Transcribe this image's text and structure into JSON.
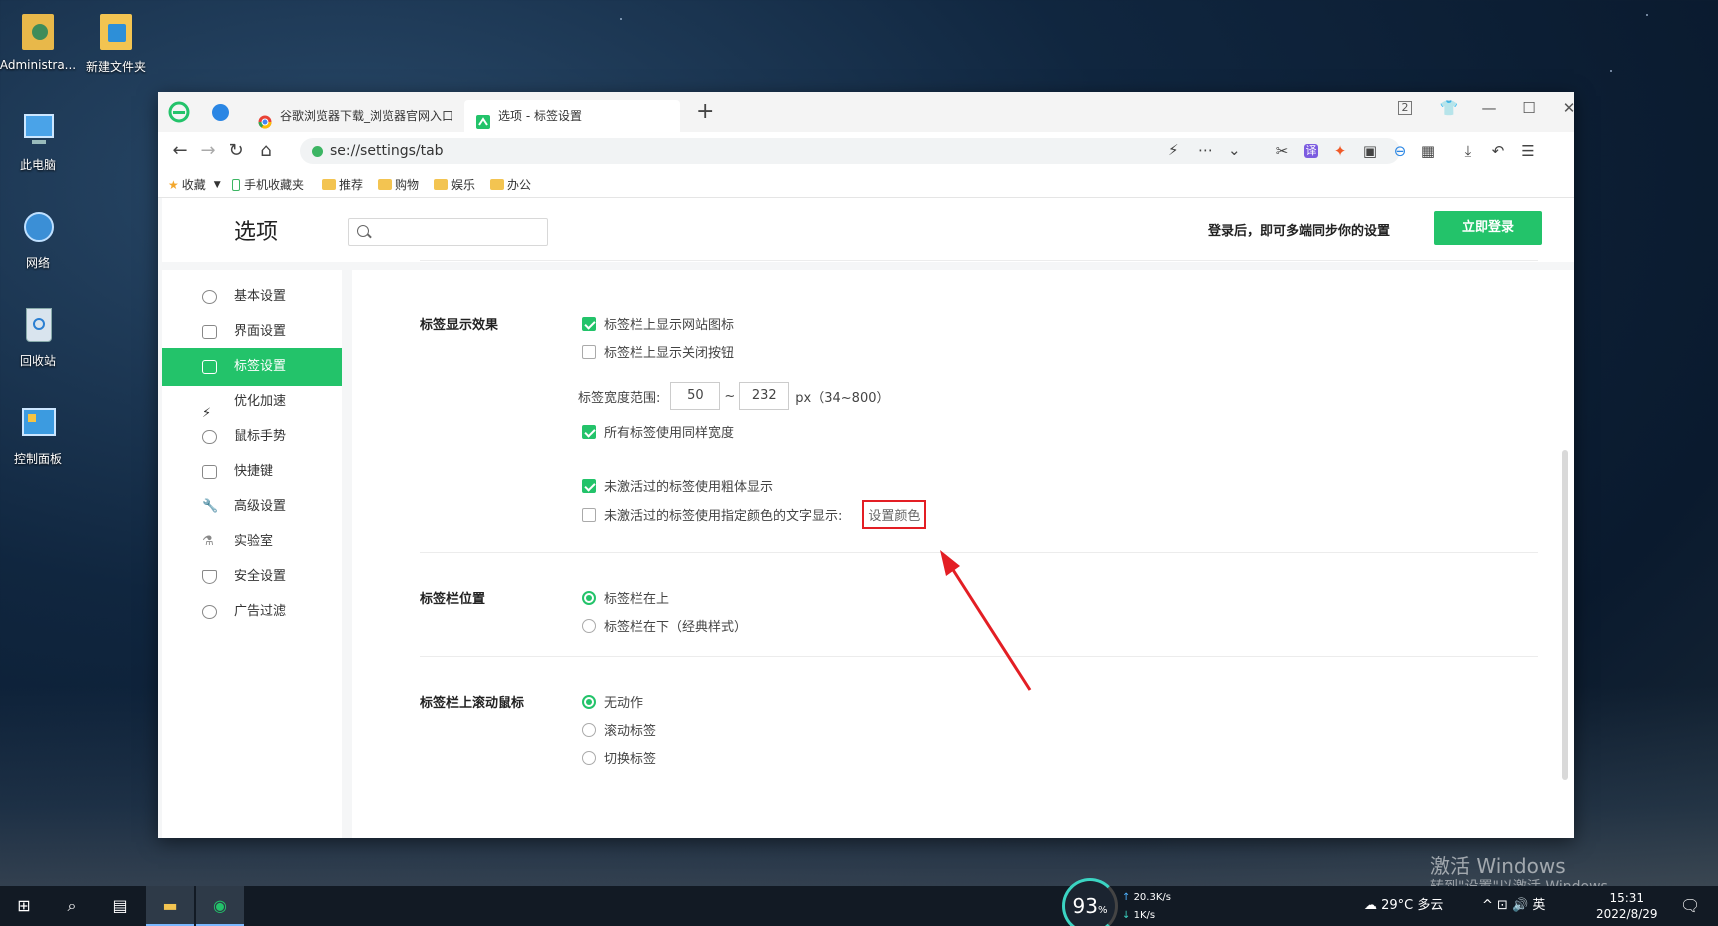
{
  "desktop": {
    "icons": [
      {
        "label": "Administra...",
        "icon": "user-folder-icon"
      },
      {
        "label": "新建文件夹",
        "icon": "folder-icon"
      },
      {
        "label": "此电脑",
        "icon": "computer-icon"
      },
      {
        "label": "网络",
        "icon": "network-icon"
      },
      {
        "label": "回收站",
        "icon": "recycle-bin-icon"
      },
      {
        "label": "控制面板",
        "icon": "control-panel-icon"
      }
    ],
    "watermark_line1": "激活 Windows",
    "watermark_line2": "转到\"设置\"以激活 Windows。"
  },
  "browser": {
    "tabs": [
      {
        "title": "谷歌浏览器下载_浏览器官网入口",
        "active": false
      },
      {
        "title": "选项 - 标签设置",
        "active": true
      }
    ],
    "new_tab": "+",
    "window_badge": "2",
    "url": "se://settings/tab",
    "bookmarks": [
      {
        "label": "收藏",
        "icon": "star-icon"
      },
      {
        "label": "手机收藏夹",
        "icon": "phone-icon"
      },
      {
        "label": "推荐",
        "icon": "folder-icon"
      },
      {
        "label": "购物",
        "icon": "folder-icon"
      },
      {
        "label": "娱乐",
        "icon": "folder-icon"
      },
      {
        "label": "办公",
        "icon": "folder-icon"
      }
    ]
  },
  "settings": {
    "title": "选项",
    "search_placeholder": "",
    "login_hint": "登录后，即可多端同步你的设置",
    "login_button": "立即登录",
    "sidebar": [
      {
        "label": "基本设置",
        "icon": "gear-icon",
        "active": false
      },
      {
        "label": "界面设置",
        "icon": "window-icon",
        "active": false
      },
      {
        "label": "标签设置",
        "icon": "tab-icon",
        "active": true
      },
      {
        "label": "优化加速",
        "icon": "lightning-icon",
        "active": false
      },
      {
        "label": "鼠标手势",
        "icon": "mouse-icon",
        "active": false
      },
      {
        "label": "快捷键",
        "icon": "keyboard-icon",
        "active": false
      },
      {
        "label": "高级设置",
        "icon": "wrench-icon",
        "active": false
      },
      {
        "label": "实验室",
        "icon": "flask-icon",
        "active": false
      },
      {
        "label": "安全设置",
        "icon": "shield-icon",
        "active": false
      },
      {
        "label": "广告过滤",
        "icon": "block-icon",
        "active": false
      }
    ],
    "sections": {
      "display": {
        "title": "标签显示效果",
        "show_favicon": {
          "label": "标签栏上显示网站图标",
          "checked": true
        },
        "show_close": {
          "label": "标签栏上显示关闭按钮",
          "checked": false
        },
        "width_label": "标签宽度范围:",
        "width_min": "50",
        "width_sep": "~",
        "width_max": "232",
        "width_unit": "px（34~800）",
        "same_width": {
          "label": "所有标签使用同样宽度",
          "checked": true
        },
        "bold_inactive": {
          "label": "未激活过的标签使用粗体显示",
          "checked": true
        },
        "color_inactive": {
          "label": "未激活过的标签使用指定颜色的文字显示:",
          "checked": false
        },
        "color_button": "设置颜色"
      },
      "position": {
        "title": "标签栏位置",
        "options": [
          {
            "label": "标签栏在上",
            "selected": true
          },
          {
            "label": "标签栏在下（经典样式）",
            "selected": false
          }
        ]
      },
      "scroll": {
        "title": "标签栏上滚动鼠标",
        "options": [
          {
            "label": "无动作",
            "selected": true
          },
          {
            "label": "滚动标签",
            "selected": false
          },
          {
            "label": "切换标签",
            "selected": false
          }
        ]
      }
    }
  },
  "taskbar": {
    "cpu_percent": "93",
    "cpu_unit": "%",
    "net_up": "20.3",
    "net_up_unit": "K/s",
    "net_down": "1",
    "net_down_unit": "K/s",
    "weather": "29°C 多云",
    "ime": "英",
    "time": "15:31",
    "date": "2022/8/29"
  },
  "colors": {
    "accent": "#23c36a",
    "annotation": "#e31e24"
  }
}
